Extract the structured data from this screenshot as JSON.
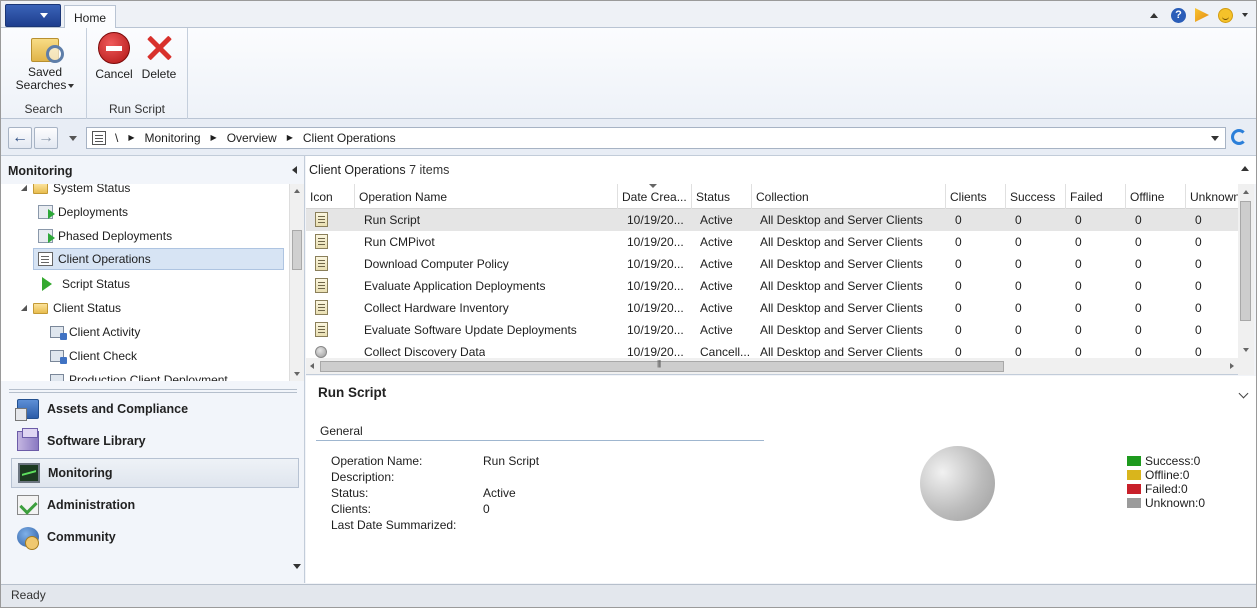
{
  "ribbon": {
    "tab_home": "Home",
    "saved_searches_line1": "Saved",
    "saved_searches_line2": "Searches",
    "cancel": "Cancel",
    "delete": "Delete",
    "group_search": "Search",
    "group_run_script": "Run Script"
  },
  "address": {
    "root": "\\",
    "crumbs": [
      "Monitoring",
      "Overview",
      "Client Operations"
    ]
  },
  "left": {
    "header": "Monitoring",
    "tree": [
      {
        "label": "System Status",
        "icon": "folder-icon"
      },
      {
        "label": "Deployments",
        "icon": "deployment-icon"
      },
      {
        "label": "Phased Deployments",
        "icon": "deployment-icon"
      },
      {
        "label": "Client Operations",
        "icon": "client-operations-icon"
      },
      {
        "label": "Script Status",
        "icon": "script-icon"
      },
      {
        "label": "Client Status",
        "icon": "folder-icon"
      },
      {
        "label": "Client Activity",
        "icon": "client-icon"
      },
      {
        "label": "Client Check",
        "icon": "client-icon"
      },
      {
        "label": "Production Client Deployment",
        "icon": "client-icon"
      }
    ],
    "workspaces": [
      {
        "label": "Assets and Compliance"
      },
      {
        "label": "Software Library"
      },
      {
        "label": "Monitoring"
      },
      {
        "label": "Administration"
      },
      {
        "label": "Community"
      }
    ]
  },
  "list": {
    "title": "Client Operations",
    "count": "7 items",
    "columns": [
      "Icon",
      "Operation Name",
      "Date Crea...",
      "Status",
      "Collection",
      "Clients",
      "Success",
      "Failed",
      "Offline",
      "Unknown"
    ],
    "rows": [
      {
        "name": "Run Script",
        "date": "10/19/20...",
        "status": "Active",
        "collection": "All Desktop and Server Clients",
        "clients": "0",
        "success": "0",
        "failed": "0",
        "offline": "0",
        "unknown": "0"
      },
      {
        "name": "Run CMPivot",
        "date": "10/19/20...",
        "status": "Active",
        "collection": "All Desktop and Server Clients",
        "clients": "0",
        "success": "0",
        "failed": "0",
        "offline": "0",
        "unknown": "0"
      },
      {
        "name": "Download Computer Policy",
        "date": "10/19/20...",
        "status": "Active",
        "collection": "All Desktop and Server Clients",
        "clients": "0",
        "success": "0",
        "failed": "0",
        "offline": "0",
        "unknown": "0"
      },
      {
        "name": "Evaluate Application Deployments",
        "date": "10/19/20...",
        "status": "Active",
        "collection": "All Desktop and Server Clients",
        "clients": "0",
        "success": "0",
        "failed": "0",
        "offline": "0",
        "unknown": "0"
      },
      {
        "name": "Collect Hardware Inventory",
        "date": "10/19/20...",
        "status": "Active",
        "collection": "All Desktop and Server Clients",
        "clients": "0",
        "success": "0",
        "failed": "0",
        "offline": "0",
        "unknown": "0"
      },
      {
        "name": "Evaluate Software Update Deployments",
        "date": "10/19/20...",
        "status": "Active",
        "collection": "All Desktop and Server Clients",
        "clients": "0",
        "success": "0",
        "failed": "0",
        "offline": "0",
        "unknown": "0"
      },
      {
        "name": "Collect Discovery Data",
        "date": "10/19/20...",
        "status": "Cancell...",
        "collection": "All Desktop and Server Clients",
        "clients": "0",
        "success": "0",
        "failed": "0",
        "offline": "0",
        "unknown": "0"
      }
    ]
  },
  "details": {
    "title": "Run Script",
    "section": "General",
    "props": [
      {
        "label": "Operation Name:",
        "value": "Run Script"
      },
      {
        "label": "Description:",
        "value": ""
      },
      {
        "label": "Status:",
        "value": "Active"
      },
      {
        "label": "Clients:",
        "value": "0"
      },
      {
        "label": "Last Date Summarized:",
        "value": ""
      }
    ],
    "legend": [
      {
        "label": "Success:0",
        "color": "#1e9a1e"
      },
      {
        "label": "Offline:0",
        "color": "#d9b51c"
      },
      {
        "label": "Failed:0",
        "color": "#c8202a"
      },
      {
        "label": "Unknown:0",
        "color": "#9b9b9b"
      }
    ]
  },
  "status_bar": "Ready"
}
